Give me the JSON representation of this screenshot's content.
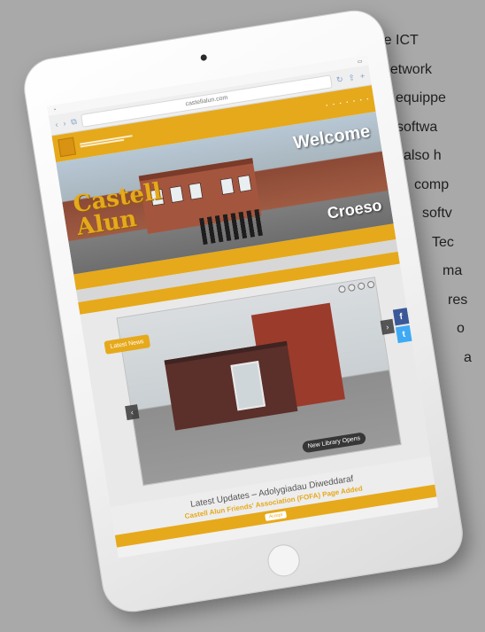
{
  "side_text": [
    "The ICT",
    "network",
    "equippe",
    "softwa",
    "also h",
    "comp",
    "softv",
    "Tec",
    "ma",
    "res",
    "o",
    "a"
  ],
  "tablet": {
    "url": "castellalun.com",
    "site": {
      "welcome": "Welcome",
      "croeso": "Croeso",
      "latest_news": "Latest News",
      "slide_caption": "New Library Opens",
      "latest_updates": "Latest Updates – Adolygiadau Diweddaraf",
      "fofa_link": "Castell Alun Friends' Association (FOFA) Page Added",
      "accept_label": "Accept"
    }
  },
  "colors": {
    "accent": "#e6a91b",
    "background": "#a9a9a9"
  }
}
